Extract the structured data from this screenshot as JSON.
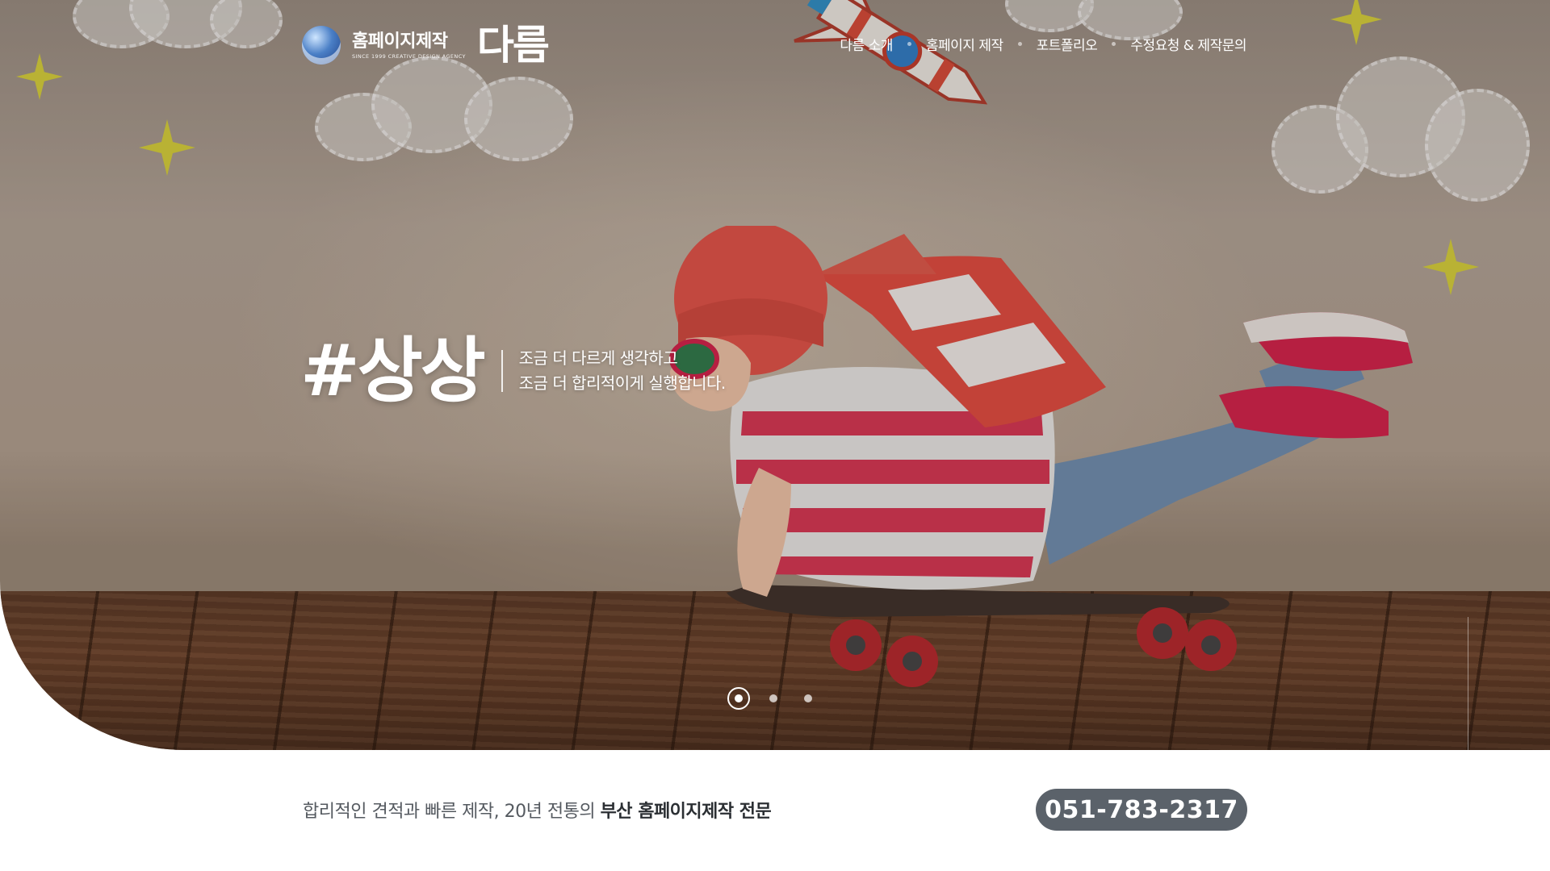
{
  "header": {
    "logo_main": "홈페이지제작",
    "logo_sub": "SINCE 1999 CREATIVE DESIGN AGENCY",
    "logo_brand": "다름",
    "nav": [
      "다름 소개",
      "홈페이지 제작",
      "포트폴리오",
      "수정요청 & 제작문의"
    ]
  },
  "hero": {
    "tag": "#상상",
    "line1": "조금 더 다르게 생각하고",
    "line2": "조금 더 합리적이게 실행합니다.",
    "slides_total": 3,
    "active_slide": 1
  },
  "footer": {
    "tagline_regular": "합리적인 견적과 빠른 제작, 20년 전통의 ",
    "tagline_bold": "부산 홈페이지제작 전문",
    "phone": "051-783-2317"
  },
  "colors": {
    "star": "#d9d33a",
    "phone_bg": "#5b626a",
    "tagline_text": "#555a60"
  }
}
